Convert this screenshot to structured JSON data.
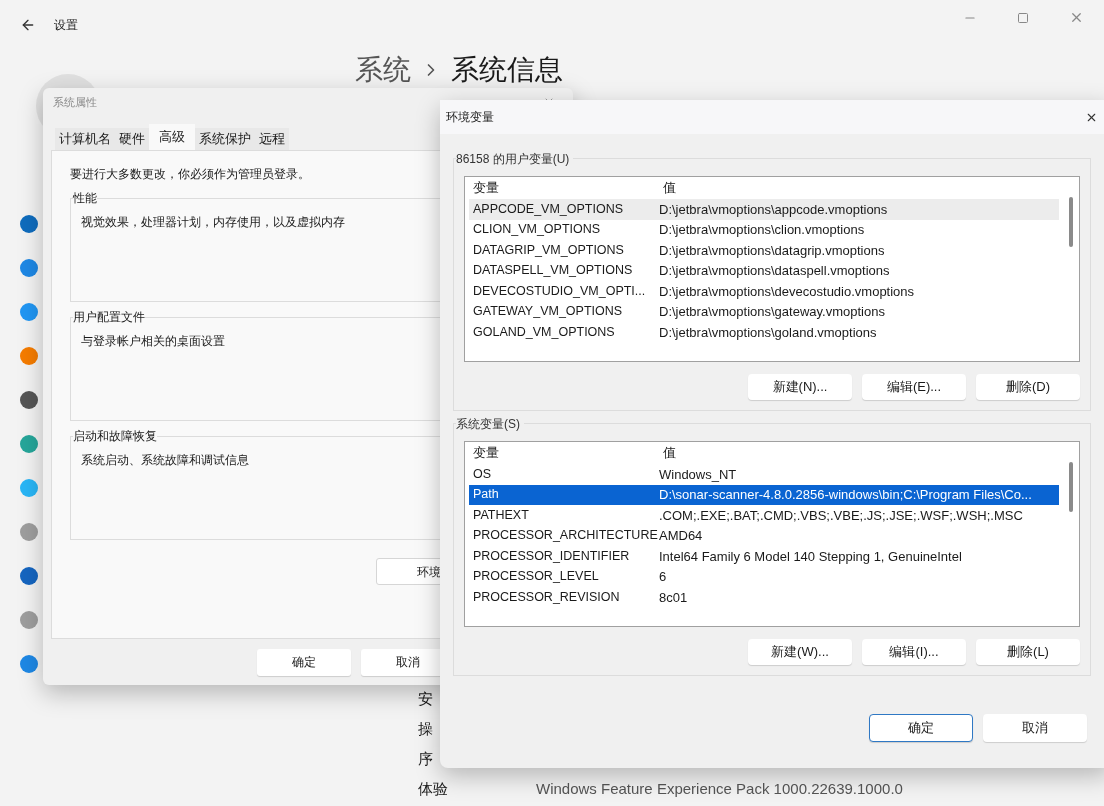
{
  "settings_window": {
    "title": "设置",
    "breadcrumb": [
      "系统",
      "系统信息"
    ],
    "info_rows": [
      {
        "label": "安"
      },
      {
        "label": "操"
      },
      {
        "label": "序"
      },
      {
        "label": "体验",
        "value": "Windows Feature Experience Pack 1000.22639.1000.0"
      }
    ]
  },
  "system_properties": {
    "title": "系统属性",
    "tabs": [
      {
        "label": "计算机名",
        "selected": false
      },
      {
        "label": "硬件",
        "selected": false
      },
      {
        "label": "高级",
        "selected": true
      },
      {
        "label": "系统保护",
        "selected": false
      },
      {
        "label": "远程",
        "selected": false
      }
    ],
    "notice": "要进行大多数更改，你必须作为管理员登录。",
    "groups": [
      {
        "title": "性能",
        "description": "视觉效果，处理器计划，内存使用，以及虚拟内存"
      },
      {
        "title": "用户配置文件",
        "description": "与登录帐户相关的桌面设置"
      },
      {
        "title": "启动和故障恢复",
        "description": "系统启动、系统故障和调试信息"
      }
    ],
    "env_button": "环境",
    "buttons": [
      "确定",
      "取消"
    ]
  },
  "environment_variables": {
    "title": "环境变量",
    "sections": [
      {
        "title": "86158 的用户变量(U)",
        "focused": false,
        "columns": [
          "变量",
          "值"
        ],
        "rows": [
          {
            "name": "APPCODE_VM_OPTIONS",
            "value": "D:\\jetbra\\vmoptions\\appcode.vmoptions",
            "selected": true
          },
          {
            "name": "CLION_VM_OPTIONS",
            "value": "D:\\jetbra\\vmoptions\\clion.vmoptions",
            "selected": false
          },
          {
            "name": "DATAGRIP_VM_OPTIONS",
            "value": "D:\\jetbra\\vmoptions\\datagrip.vmoptions",
            "selected": false
          },
          {
            "name": "DATASPELL_VM_OPTIONS",
            "value": "D:\\jetbra\\vmoptions\\dataspell.vmoptions",
            "selected": false
          },
          {
            "name": "DEVECOSTUDIO_VM_OPTI...",
            "value": "D:\\jetbra\\vmoptions\\devecostudio.vmoptions",
            "selected": false
          },
          {
            "name": "GATEWAY_VM_OPTIONS",
            "value": "D:\\jetbra\\vmoptions\\gateway.vmoptions",
            "selected": false
          },
          {
            "name": "GOLAND_VM_OPTIONS",
            "value": "D:\\jetbra\\vmoptions\\goland.vmoptions",
            "selected": false
          }
        ],
        "buttons": [
          "新建(N)...",
          "编辑(E)...",
          "删除(D)"
        ]
      },
      {
        "title": "系统变量(S)",
        "focused": true,
        "columns": [
          "变量",
          "值"
        ],
        "rows": [
          {
            "name": "OS",
            "value": "Windows_NT",
            "selected": false
          },
          {
            "name": "Path",
            "value": "D:\\sonar-scanner-4.8.0.2856-windows\\bin;C:\\Program Files\\Co...",
            "selected": true
          },
          {
            "name": "PATHEXT",
            "value": ".COM;.EXE;.BAT;.CMD;.VBS;.VBE;.JS;.JSE;.WSF;.WSH;.MSC",
            "selected": false
          },
          {
            "name": "PROCESSOR_ARCHITECTURE",
            "value": "AMD64",
            "selected": false
          },
          {
            "name": "PROCESSOR_IDENTIFIER",
            "value": "Intel64 Family 6 Model 140 Stepping 1, GenuineIntel",
            "selected": false
          },
          {
            "name": "PROCESSOR_LEVEL",
            "value": "6",
            "selected": false
          },
          {
            "name": "PROCESSOR_REVISION",
            "value": "8c01",
            "selected": false
          }
        ],
        "buttons": [
          "新建(W)...",
          "编辑(I)...",
          "删除(L)"
        ]
      }
    ],
    "buttons": [
      {
        "label": "确定",
        "default": true
      },
      {
        "label": "取消",
        "default": false
      }
    ]
  }
}
